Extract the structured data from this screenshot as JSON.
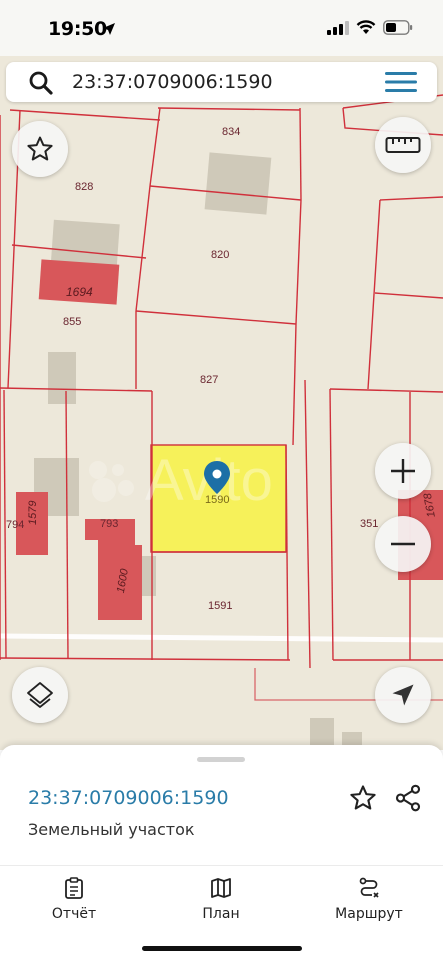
{
  "status": {
    "time": "19:50"
  },
  "search": {
    "query": "23:37:0709006:1590"
  },
  "map": {
    "parcel_labels": [
      "834",
      "828",
      "820",
      "1694",
      "855",
      "827",
      "1590",
      "1579",
      "794",
      "793",
      "1600",
      "1591",
      "351",
      "1678"
    ],
    "selected_parcel": "1590",
    "watermark": "Avito",
    "colors": {
      "background": "#ede8da",
      "boundary": "#d0303b",
      "building": "#d8575a",
      "structure": "#cfc9b9",
      "selected_fill": "#f6f15a"
    }
  },
  "controls": {
    "favorite": "star-icon",
    "ruler": "ruler-icon",
    "zoom_in": "plus-icon",
    "zoom_out": "minus-icon",
    "layers": "layers-icon",
    "locate": "navigation-arrow-icon"
  },
  "sheet": {
    "title": "23:37:0709006:1590",
    "subtitle": "Земельный участок"
  },
  "tabs": [
    {
      "label": "Отчёт",
      "icon": "report-icon"
    },
    {
      "label": "План",
      "icon": "map-plan-icon"
    },
    {
      "label": "Маршрут",
      "icon": "route-icon"
    }
  ]
}
